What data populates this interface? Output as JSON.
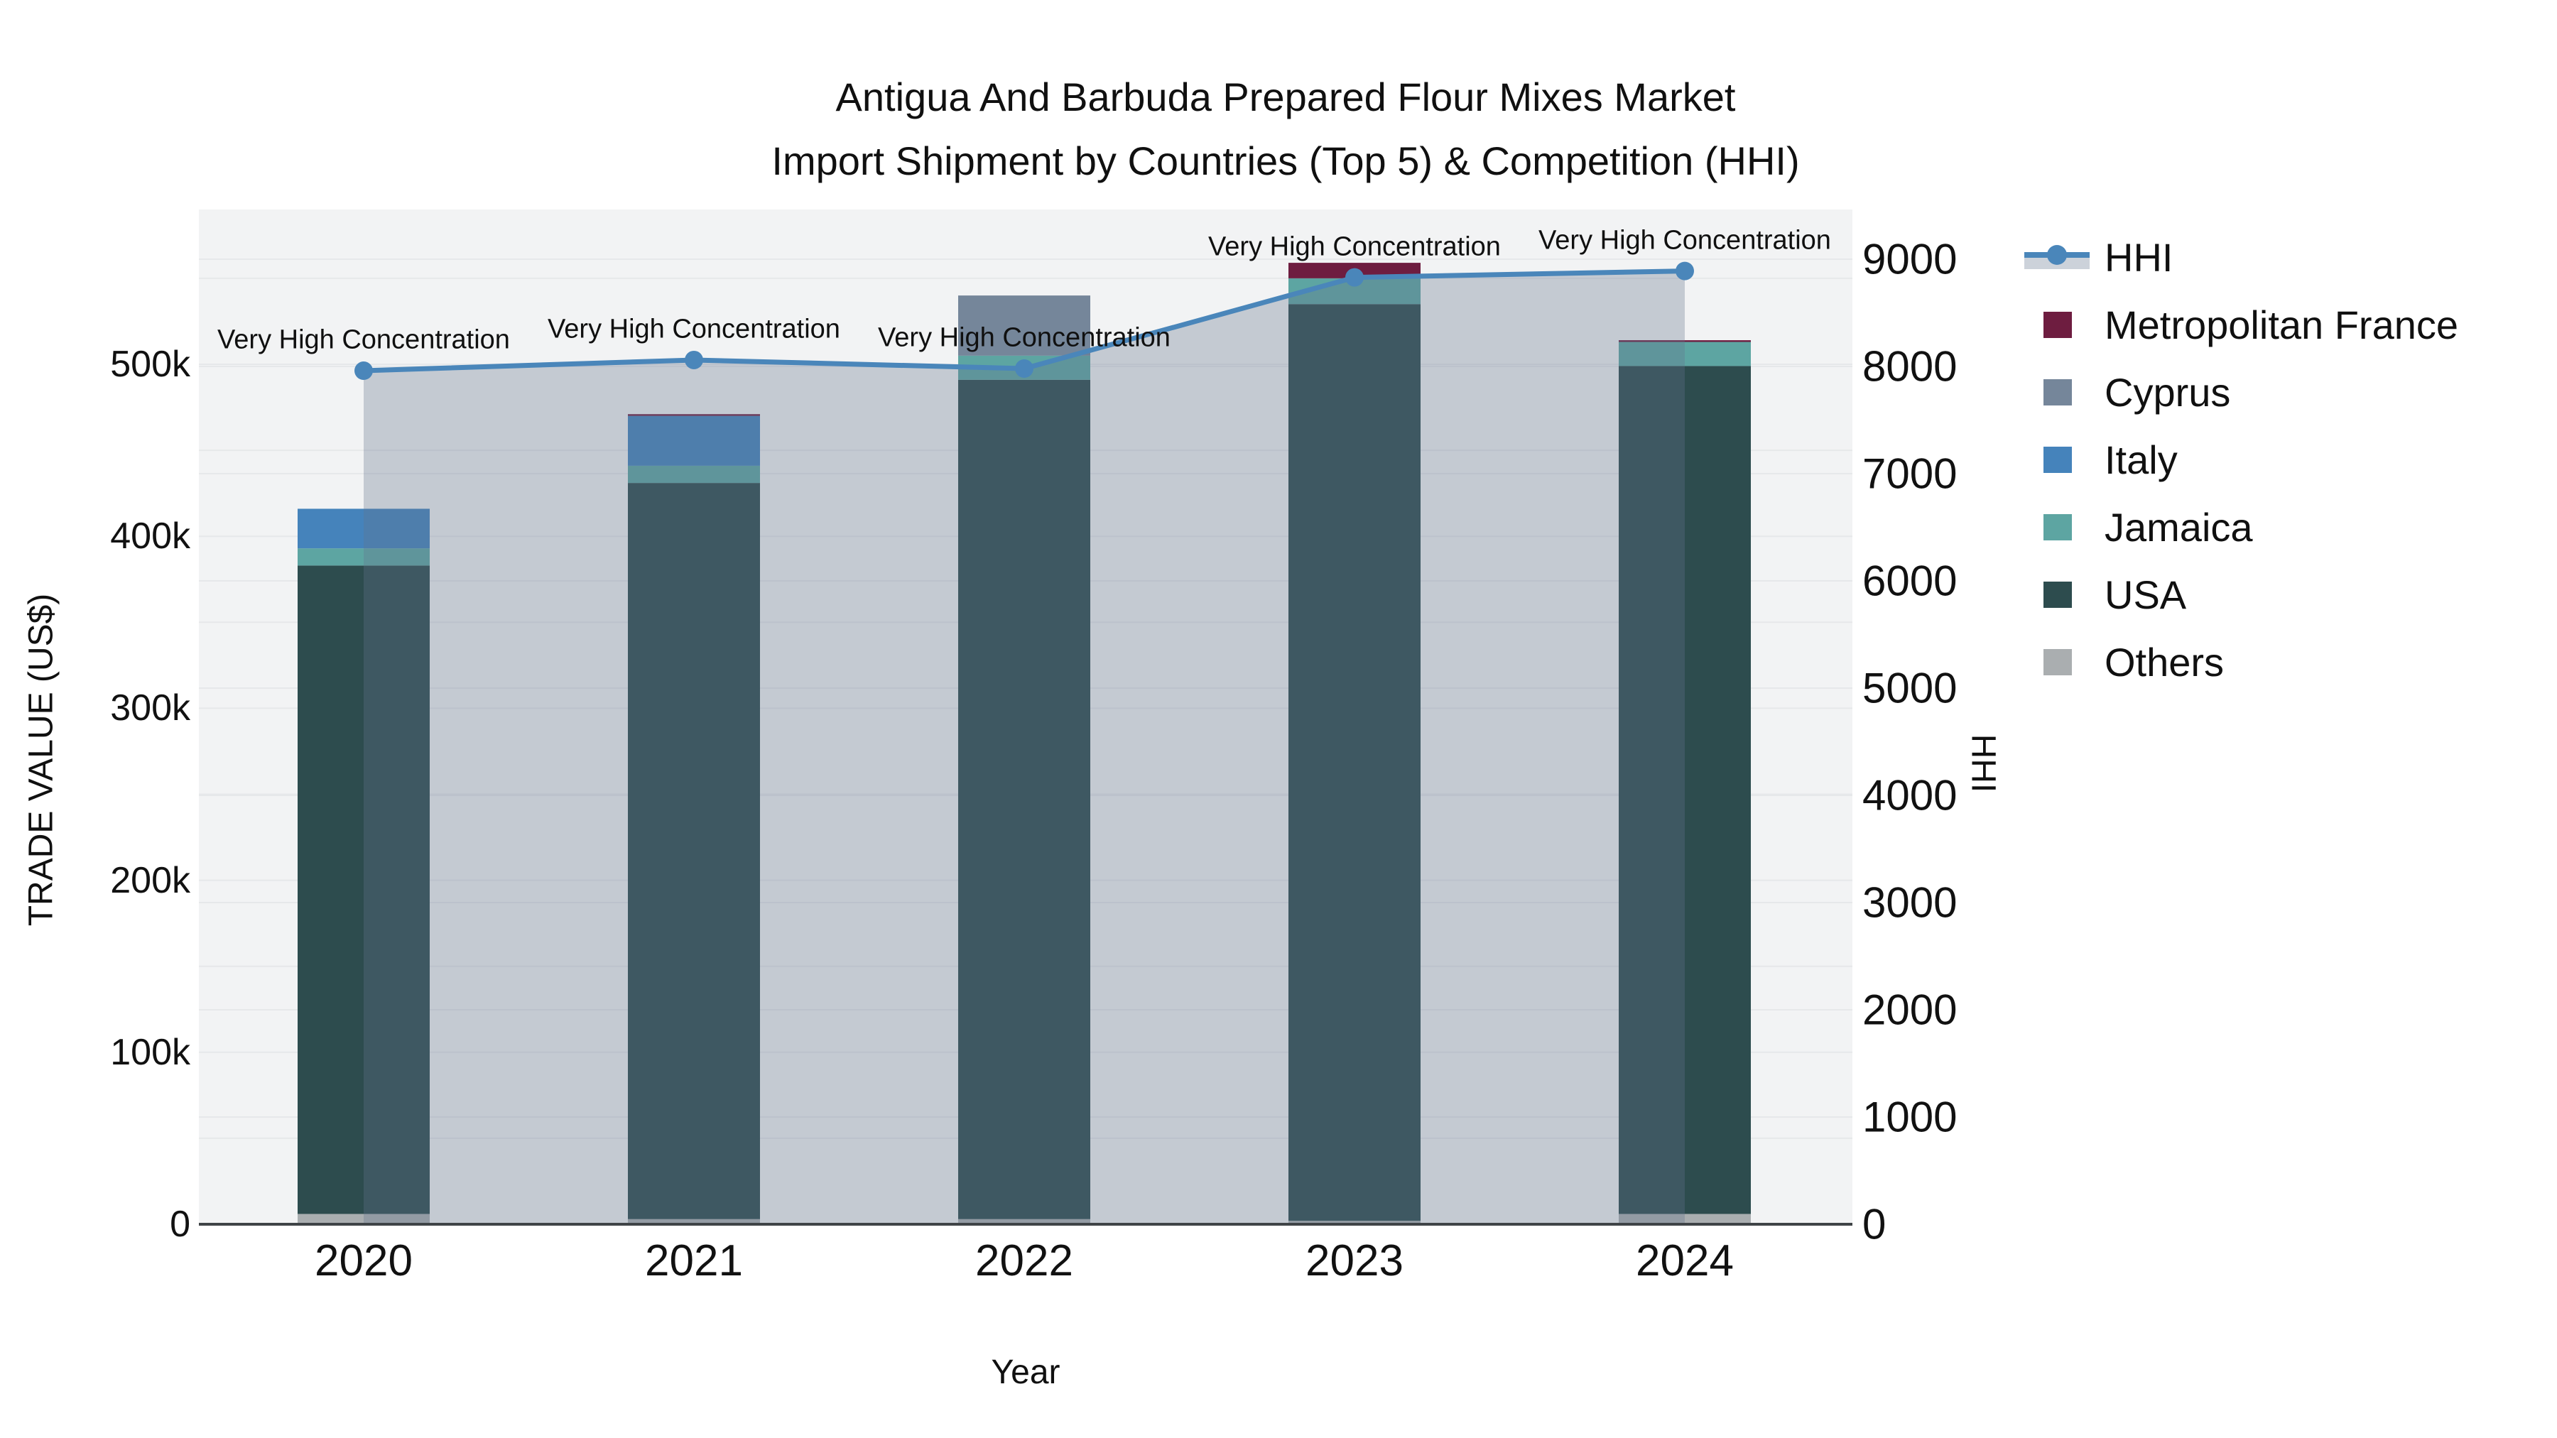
{
  "title": {
    "line1": "Antigua And Barbuda Prepared Flour Mixes Market",
    "line2": "Import Shipment by Countries (Top 5) & Competition (HHI)"
  },
  "axes": {
    "x": {
      "title": "Year",
      "categories": [
        "2020",
        "2021",
        "2022",
        "2023",
        "2024"
      ]
    },
    "y_left": {
      "title": "TRADE VALUE (US$)",
      "tick_labels": [
        "0",
        "100k",
        "200k",
        "300k",
        "400k",
        "500k"
      ],
      "tick_step": 100000,
      "range": [
        0,
        590000
      ]
    },
    "y_right": {
      "title": "HHI",
      "tick_labels": [
        "0",
        "1000",
        "2000",
        "3000",
        "4000",
        "5000",
        "6000",
        "7000",
        "8000",
        "9000"
      ],
      "tick_step": 1000,
      "range": [
        0,
        9450
      ]
    }
  },
  "legend": [
    {
      "label": "HHI",
      "type": "line",
      "color": "#4a86ba"
    },
    {
      "label": "Metropolitan France",
      "type": "bar",
      "color": "#6e1d40"
    },
    {
      "label": "Cyprus",
      "type": "bar",
      "color": "#75869a"
    },
    {
      "label": "Italy",
      "type": "bar",
      "color": "#4583bb"
    },
    {
      "label": "Jamaica",
      "type": "bar",
      "color": "#5da5a2"
    },
    {
      "label": "USA",
      "type": "bar",
      "color": "#2d4c4e"
    },
    {
      "label": "Others",
      "type": "bar",
      "color": "#aaaeb0"
    }
  ],
  "annotations": [
    {
      "text": "Very High Concentration",
      "category": "2020"
    },
    {
      "text": "Very High Concentration",
      "category": "2021"
    },
    {
      "text": "Very High Concentration",
      "category": "2022"
    },
    {
      "text": "Very High Concentration",
      "category": "2023"
    },
    {
      "text": "Very High Concentration",
      "category": "2024"
    }
  ],
  "chart_data": {
    "type": "bar",
    "subtype": "stacked-bar-with-line",
    "title": "Antigua And Barbuda Prepared Flour Mixes Market Import Shipment by Countries (Top 5) & Competition (HHI)",
    "xlabel": "Year",
    "ylabel_left": "TRADE VALUE (US$)",
    "ylabel_right": "HHI",
    "categories": [
      "2020",
      "2021",
      "2022",
      "2023",
      "2024"
    ],
    "bar_value_unit": "US$",
    "series": [
      {
        "name": "Metropolitan France",
        "color": "#6e1d40",
        "values": [
          0,
          1000,
          0,
          9000,
          1000
        ]
      },
      {
        "name": "Cyprus",
        "color": "#75869a",
        "values": [
          0,
          0,
          35000,
          0,
          0
        ]
      },
      {
        "name": "Italy",
        "color": "#4583bb",
        "values": [
          23000,
          29000,
          0,
          0,
          0
        ]
      },
      {
        "name": "Jamaica",
        "color": "#5da5a2",
        "values": [
          10000,
          10000,
          14000,
          15000,
          14000
        ]
      },
      {
        "name": "USA",
        "color": "#2d4c4e",
        "values": [
          377000,
          428000,
          488000,
          533000,
          493000
        ]
      },
      {
        "name": "Others",
        "color": "#aaaeb0",
        "values": [
          6000,
          3000,
          3000,
          2000,
          6000
        ]
      }
    ],
    "bar_totals": [
      416000,
      471000,
      540000,
      559000,
      514000
    ],
    "line": {
      "name": "HHI",
      "axis": "right",
      "color": "#4a86ba",
      "fill_color": "rgba(100,115,140,0.32)",
      "values": [
        7960,
        8060,
        7980,
        8830,
        8890
      ]
    },
    "ylim_left": [
      0,
      590000
    ],
    "ylim_right": [
      0,
      9450
    ],
    "grid": true,
    "legend_position": "right",
    "plot_bg": "#f2f3f4"
  }
}
